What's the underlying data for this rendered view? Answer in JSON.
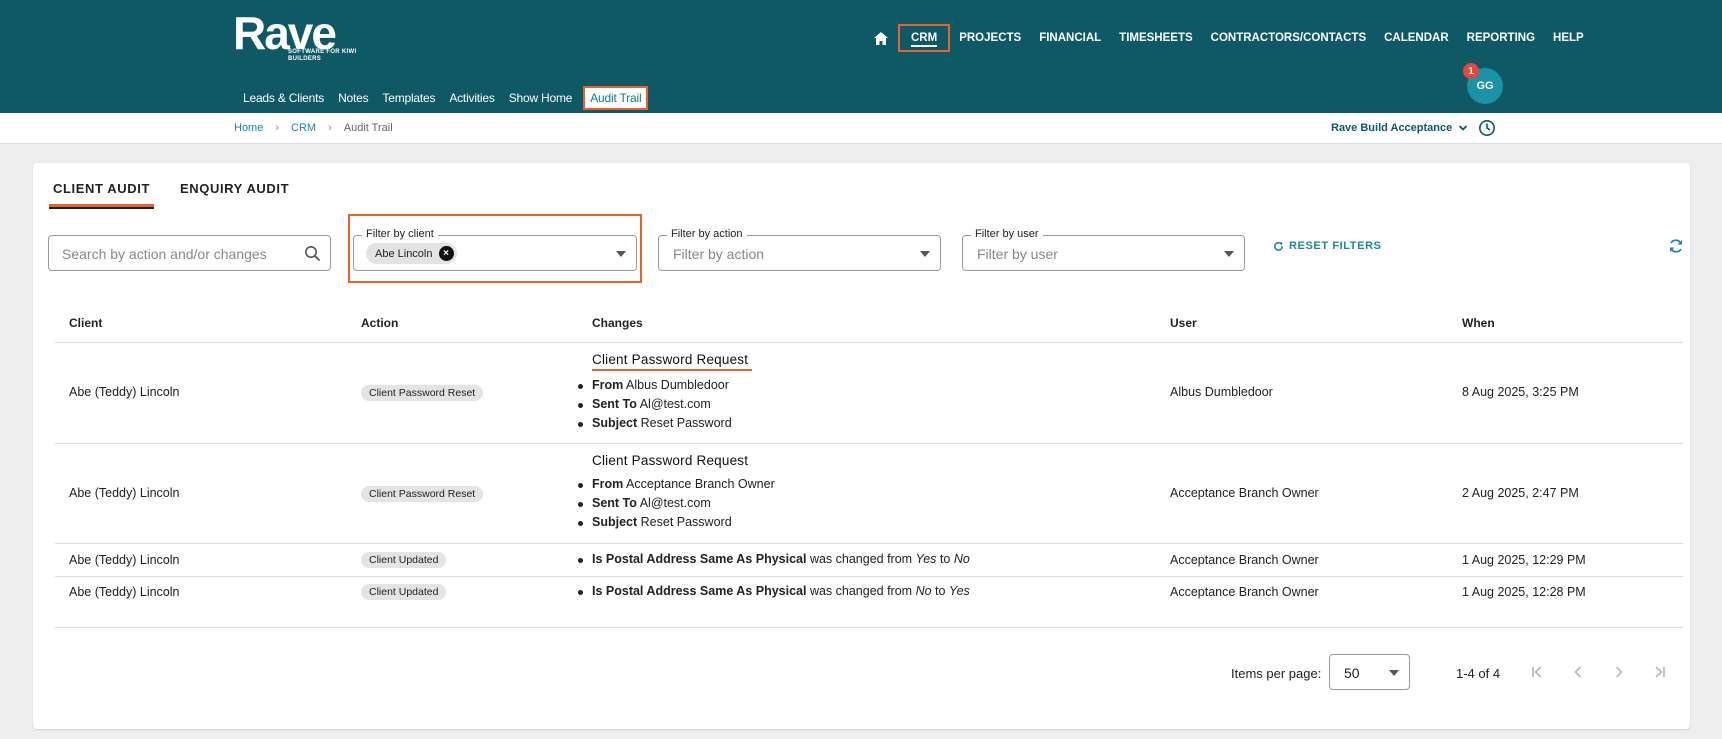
{
  "logo": {
    "word": "Rave",
    "tagline": "SOFTWARE FOR KIWI BUILDERS"
  },
  "main_nav": [
    "CRM",
    "PROJECTS",
    "FINANCIAL",
    "TIMESHEETS",
    "CONTRACTORS/CONTACTS",
    "CALENDAR",
    "REPORTING",
    "HELP"
  ],
  "main_nav_active": "CRM",
  "sub_nav": [
    "Leads & Clients",
    "Notes",
    "Templates",
    "Activities",
    "Show Home",
    "Audit Trail"
  ],
  "sub_nav_active": "Audit Trail",
  "user": {
    "initials": "GG",
    "notifications": "1"
  },
  "breadcrumb": {
    "home": "Home",
    "section": "CRM",
    "current": "Audit Trail",
    "sep": "›"
  },
  "environment": "Rave Build Acceptance",
  "tabs": {
    "client_audit": "CLIENT AUDIT",
    "enquiry_audit": "ENQUIRY AUDIT"
  },
  "search": {
    "placeholder": "Search by action and/or changes"
  },
  "filters": {
    "client": {
      "label": "Filter by client",
      "chip": "Abe Lincoln",
      "chip_remove": "×"
    },
    "action": {
      "label": "Filter by action",
      "placeholder": "Filter by action"
    },
    "user": {
      "label": "Filter by user",
      "placeholder": "Filter by user"
    },
    "reset_label": "RESET FILTERS"
  },
  "table": {
    "headers": {
      "client": "Client",
      "action": "Action",
      "changes": "Changes",
      "user": "User",
      "when": "When"
    },
    "rows": [
      {
        "client": "Abe (Teddy) Lincoln",
        "action": "Client Password Reset",
        "title": "Client Password Request",
        "items": [
          {
            "key": "From",
            "value": "Albus Dumbledoor"
          },
          {
            "key": "Sent To",
            "value": "Al@test.com"
          },
          {
            "key": "Subject",
            "value": "Reset Password"
          }
        ],
        "user": "Albus Dumbledoor",
        "when": "8 Aug 2025, 3:25 PM"
      },
      {
        "client": "Abe (Teddy) Lincoln",
        "action": "Client Password Reset",
        "title": "Client Password Request",
        "items": [
          {
            "key": "From",
            "value": "Acceptance Branch Owner"
          },
          {
            "key": "Sent To",
            "value": "Al@test.com"
          },
          {
            "key": "Subject",
            "value": "Reset Password"
          }
        ],
        "user": "Acceptance Branch Owner",
        "when": "2 Aug 2025, 2:47 PM"
      },
      {
        "client": "Abe (Teddy) Lincoln",
        "action": "Client Updated",
        "field": "Is Postal Address Same As Physical",
        "changed_text": "was changed from",
        "from": "Yes",
        "to_word": "to",
        "to": "No",
        "user": "Acceptance Branch Owner",
        "when": "1 Aug 2025, 12:29 PM"
      },
      {
        "client": "Abe (Teddy) Lincoln",
        "action": "Client Updated",
        "field": "Is Postal Address Same As Physical",
        "changed_text": "was changed from",
        "from": "No",
        "to_word": "to",
        "to": "Yes",
        "user": "Acceptance Branch Owner",
        "when": "1 Aug 2025, 12:28 PM"
      }
    ]
  },
  "pagination": {
    "items_per_page_label": "Items per page:",
    "items_per_page": "50",
    "range": "1-4 of 4"
  },
  "colors": {
    "header": "#0f5866",
    "accent": "#e8622a",
    "link": "#1a86a0"
  }
}
